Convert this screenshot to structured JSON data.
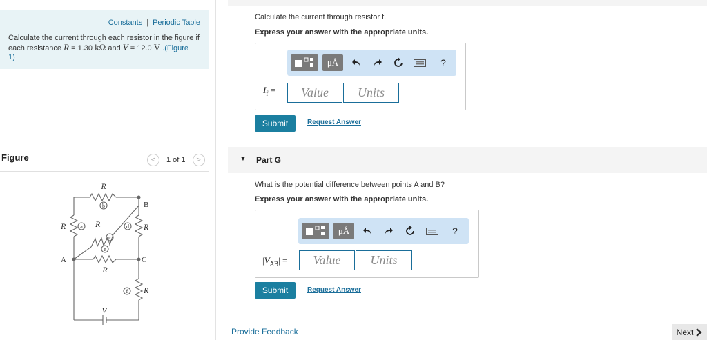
{
  "left": {
    "links": {
      "constants": "Constants",
      "separator": "|",
      "periodic_table": "Periodic Table"
    },
    "problem": {
      "line1": "Calculate the current through each resistor in the figure if",
      "line2_a": "each resistance",
      "R_var": "R",
      "eq1": "= 1.30",
      "unit_R": "kΩ",
      "and": "and",
      "V_var": "V",
      "eq2": "= 12.0",
      "unit_V": "V",
      "figure_link_a": ".(Figure",
      "figure_link_b": "1)"
    },
    "figure": {
      "title": "Figure",
      "pager": {
        "prev": "<",
        "count": "1 of 1",
        "next": ">"
      },
      "circuit_labels": {
        "R_top": "R",
        "b": "b",
        "B": "B",
        "R_left": "R",
        "a": "a",
        "R_diag": "R",
        "c": "c",
        "d": "d",
        "R_right": "R",
        "e": "e",
        "A": "A",
        "C": "C",
        "R_mid": "R",
        "f": "f",
        "R_bottom_right": "R",
        "V": "V"
      }
    }
  },
  "part_f": {
    "question": "Calculate the current through resistor f.",
    "instruction": "Express your answer with the appropriate units.",
    "toolbar": {
      "unit_button": "μÅ",
      "help": "?"
    },
    "label_var": "I",
    "label_sub": "f",
    "label_eq": "=",
    "value_placeholder": "Value",
    "units_placeholder": "Units",
    "submit": "Submit",
    "request": "Request Answer"
  },
  "part_g": {
    "title": "Part G",
    "question": "What is the potential difference between points A and B?",
    "instruction": "Express your answer with the appropriate units.",
    "toolbar": {
      "unit_button": "μÅ",
      "help": "?"
    },
    "label_open": "|",
    "label_var": "V",
    "label_sub": "AB",
    "label_close": "|",
    "label_eq": "=",
    "value_placeholder": "Value",
    "units_placeholder": "Units",
    "submit": "Submit",
    "request": "Request Answer"
  },
  "footer": {
    "feedback": "Provide Feedback",
    "next": "Next"
  }
}
